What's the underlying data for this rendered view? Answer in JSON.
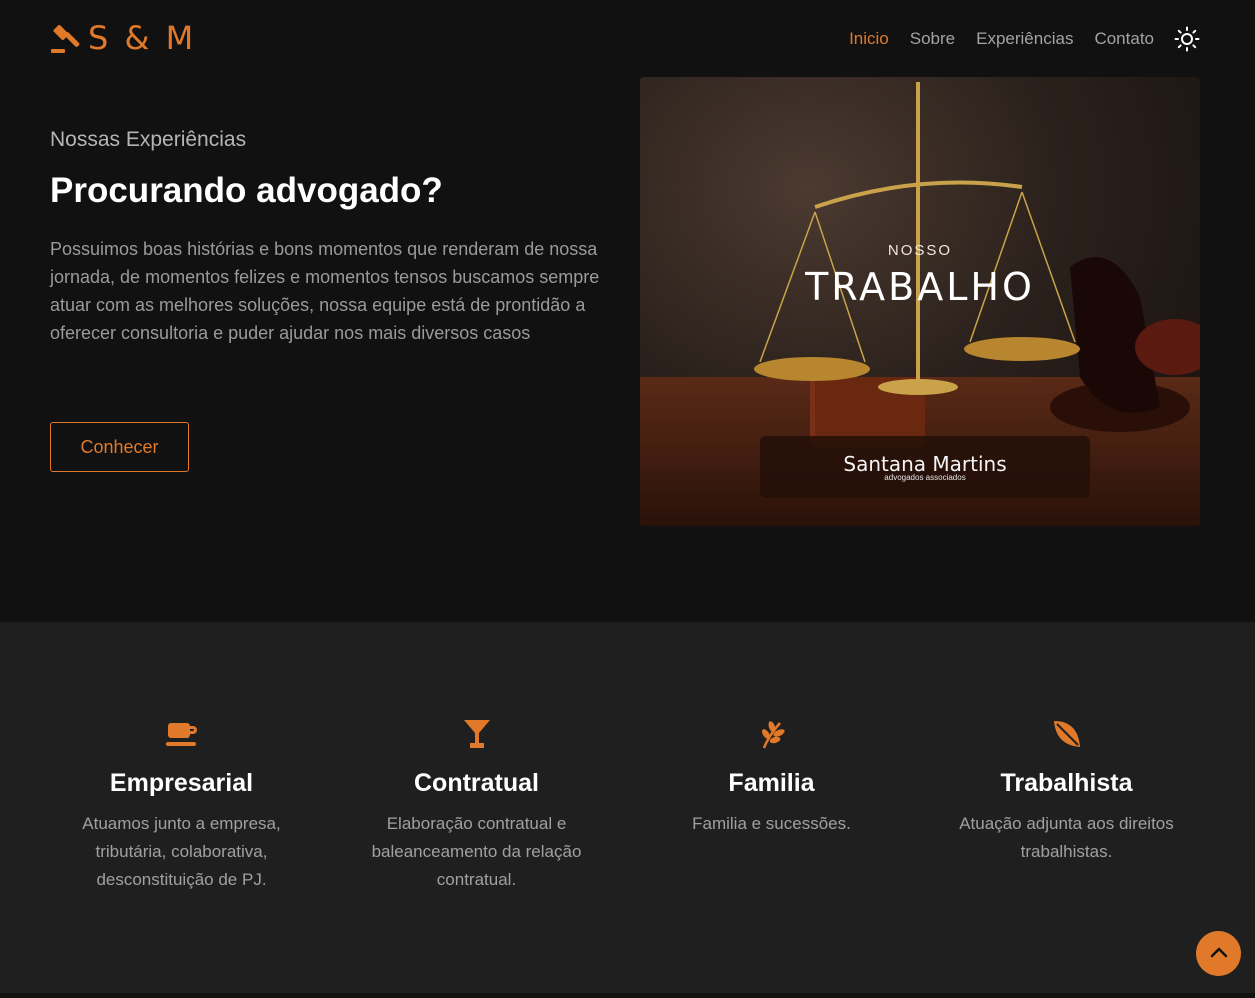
{
  "brand": {
    "logo_text": "S & M",
    "logo_icon": "gavel-icon"
  },
  "nav": {
    "items": [
      "Inicio",
      "Sobre",
      "Experiências",
      "Contato"
    ],
    "active": "Inicio",
    "theme_icon": "sun-icon"
  },
  "hero": {
    "eyebrow": "Nossas Experiências",
    "title": "Procurando advogado?",
    "text": "Possuimos boas histórias e bons momentos que renderam de nossa jornada, de momentos felizes e momentos tensos buscamos sempre atuar com as melhores soluções, nossa equipe está de prontidão a oferecer consultoria e puder ajudar nos mais diversos casos",
    "cta_label": "Conhecer",
    "image": {
      "subtitle": "NOSSO",
      "title": "TRABALHO",
      "brand_name": "Santana Martins",
      "brand_tagline": "advogados associados"
    }
  },
  "services": [
    {
      "icon": "coffee-cup-icon",
      "title": "Empresarial",
      "text": "Atuamos junto a empresa, tributária, colaborativa, desconstituição de PJ."
    },
    {
      "icon": "cocktail-glass-icon",
      "title": "Contratual",
      "text": "Elaboração contratual e baleanceamento da relação contratual."
    },
    {
      "icon": "seedling-icon",
      "title": "Familia",
      "text": "Familia e sucessões."
    },
    {
      "icon": "leaf-icon",
      "title": "Trabalhista",
      "text": "Atuação adjunta aos direitos trabalhistas."
    }
  ],
  "colors": {
    "accent": "#e07a2a",
    "background": "#111111",
    "section_bg": "#1f1f1f"
  },
  "scroll_top_icon": "chevron-up-icon"
}
